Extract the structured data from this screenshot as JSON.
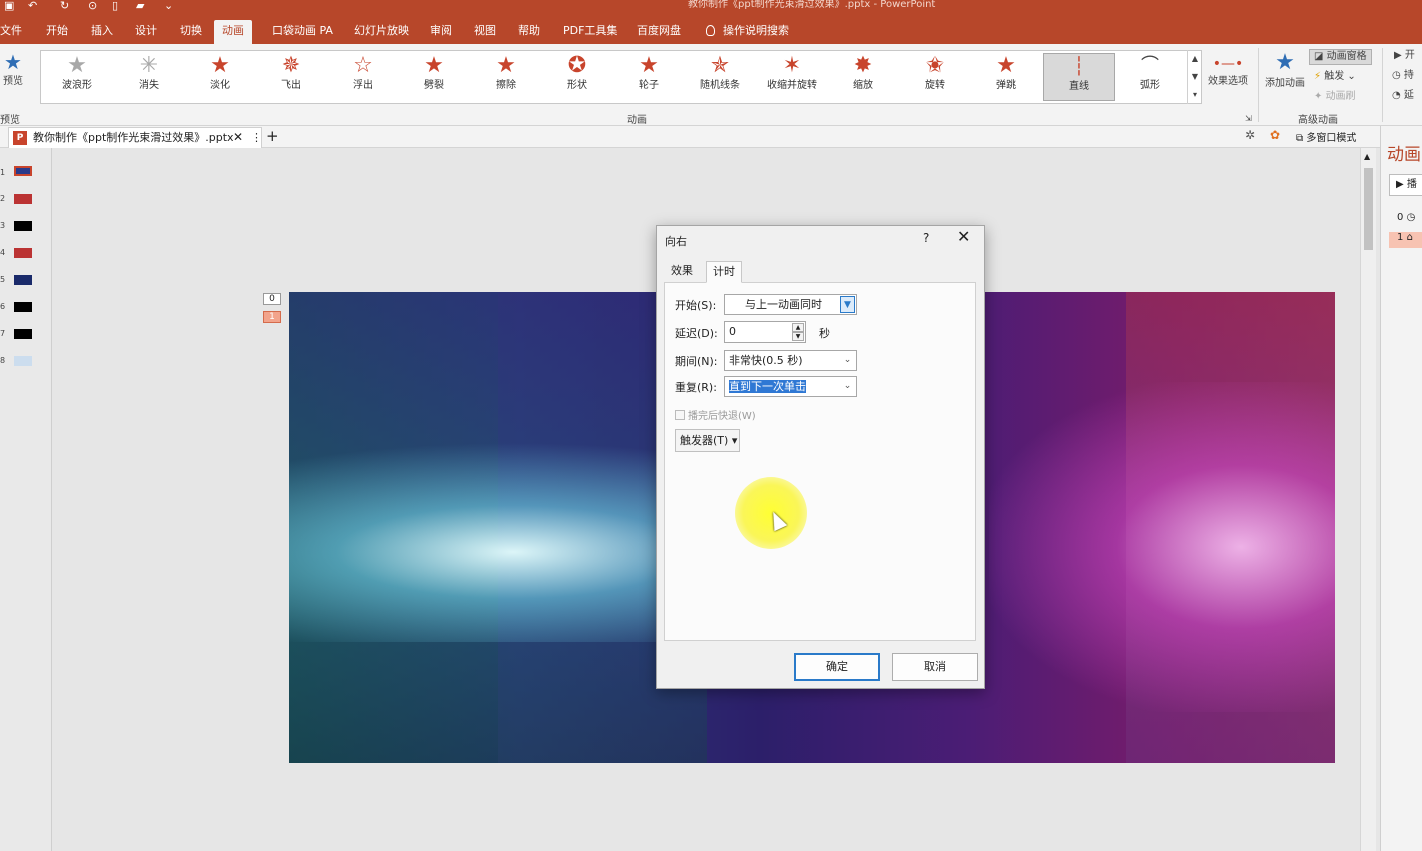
{
  "window": {
    "title": "教你制作《ppt制作光束滑过效果》.pptx  -  PowerPoint"
  },
  "menu": {
    "tabs": [
      {
        "label": "文件"
      },
      {
        "label": "开始"
      },
      {
        "label": "插入"
      },
      {
        "label": "设计"
      },
      {
        "label": "切换"
      },
      {
        "label": "动画"
      },
      {
        "label": "口袋动画 PA"
      },
      {
        "label": "幻灯片放映"
      },
      {
        "label": "审阅"
      },
      {
        "label": "视图"
      },
      {
        "label": "帮助"
      },
      {
        "label": "PDF工具集"
      },
      {
        "label": "百度网盘"
      }
    ],
    "active_tab": "动画",
    "search_label": "操作说明搜索"
  },
  "ribbon": {
    "preview_label": "预览",
    "preview_group": "预览",
    "animations": [
      {
        "label": "波浪形",
        "icon": "star-icon"
      },
      {
        "label": "消失",
        "icon": "star-icon"
      },
      {
        "label": "淡化",
        "icon": "star-icon"
      },
      {
        "label": "飞出",
        "icon": "star-icon"
      },
      {
        "label": "浮出",
        "icon": "star-icon"
      },
      {
        "label": "劈裂",
        "icon": "star-icon"
      },
      {
        "label": "擦除",
        "icon": "star-icon"
      },
      {
        "label": "形状",
        "icon": "star-icon"
      },
      {
        "label": "轮子",
        "icon": "star-icon"
      },
      {
        "label": "随机线条",
        "icon": "star-icon"
      },
      {
        "label": "收缩并旋转",
        "icon": "star-icon"
      },
      {
        "label": "缩放",
        "icon": "star-icon"
      },
      {
        "label": "旋转",
        "icon": "star-icon"
      },
      {
        "label": "弹跳",
        "icon": "star-icon"
      },
      {
        "label": "直线",
        "icon": "line-path-icon"
      },
      {
        "label": "弧形",
        "icon": "arc-path-icon"
      }
    ],
    "selected_animation": "直线",
    "animation_group": "动画",
    "effect_options": "效果选项",
    "add_animation": "添加动画",
    "animation_pane": "动画窗格",
    "trigger": "触发",
    "animation_painter": "动画刷",
    "advanced_group": "高级动画",
    "timing_start": "开",
    "timing_duration": "持",
    "timing_delay": "延"
  },
  "docbar": {
    "doc_tab": "教你制作《ppt制作光束滑过效果》.pptx",
    "multi_window": "多窗口模式"
  },
  "thumbnails": {
    "numbers": [
      "1",
      "2",
      "3",
      "4",
      "5",
      "6",
      "7",
      "8"
    ]
  },
  "slide": {
    "anim_tags": [
      "0",
      "1"
    ]
  },
  "animation_pane": {
    "title": "动画",
    "play": "播",
    "items": [
      "0",
      "1"
    ]
  },
  "dialog": {
    "title": "向右",
    "help": "?",
    "tabs": [
      "效果",
      "计时"
    ],
    "active_tab": "计时",
    "start_label": "开始(S):",
    "start_value": "与上一动画同时",
    "delay_label": "延迟(D):",
    "delay_value": "0",
    "delay_unit": "秒",
    "duration_label": "期间(N):",
    "duration_value": "非常快(0.5 秒)",
    "repeat_label": "重复(R):",
    "repeat_value": "直到下一次单击",
    "rewind_label": "播完后快退(W)",
    "rewind_checked": false,
    "trigger_label": "触发器(T)",
    "ok": "确定",
    "cancel": "取消"
  },
  "colors": {
    "accent": "#b7472a",
    "star": "#c8442c",
    "focus": "#2a7ac9"
  }
}
